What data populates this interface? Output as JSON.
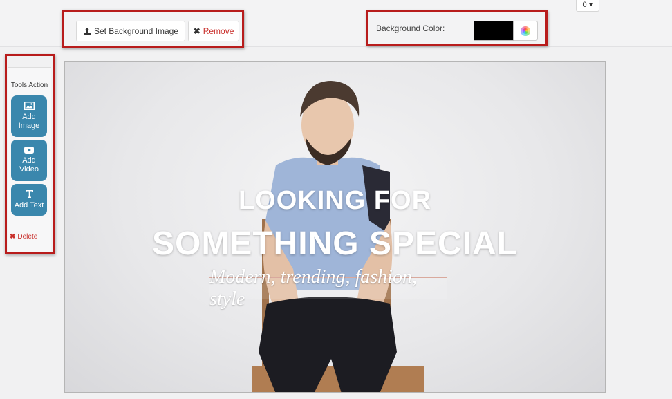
{
  "top": {
    "dropdown_value": "0"
  },
  "background_image": {
    "set_label": "Set Background Image",
    "remove_label": "Remove"
  },
  "background_color": {
    "label": "Background Color:",
    "value": "#000000"
  },
  "tools": {
    "title": "Tools Action",
    "buttons": [
      {
        "label": "Add\nImage",
        "icon": "image-icon"
      },
      {
        "label": "Add\nVideo",
        "icon": "video-play-icon"
      },
      {
        "label": "Add Text",
        "icon": "text-icon"
      }
    ],
    "delete_label": "Delete"
  },
  "canvas": {
    "line1": "LOOKING FOR",
    "line2": "SOMETHING SPECIAL",
    "line3": "Modern, trending, fashion, style"
  },
  "colors": {
    "accent": "#3a87ad",
    "danger": "#c9302c",
    "highlight": "#b81c1c"
  }
}
